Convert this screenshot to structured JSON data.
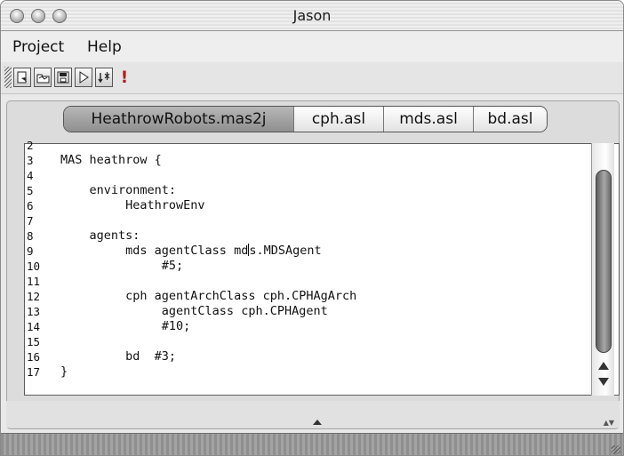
{
  "window": {
    "title": "Jason"
  },
  "menu": {
    "items": [
      "Project",
      "Help"
    ]
  },
  "toolbar": {
    "buttons": [
      {
        "icon": "new-project-icon"
      },
      {
        "icon": "open-project-icon"
      },
      {
        "icon": "save-icon"
      },
      {
        "icon": "run-icon"
      },
      {
        "icon": "debug-icon"
      },
      {
        "icon": "stop-icon",
        "symbol": "!"
      }
    ]
  },
  "tabs": [
    {
      "label": "HeathrowRobots.mas2j",
      "active": true
    },
    {
      "label": "cph.asl",
      "active": false
    },
    {
      "label": "mds.asl",
      "active": false
    },
    {
      "label": "bd.asl",
      "active": false
    }
  ],
  "editor": {
    "lines": [
      {
        "n": "2",
        "text": ""
      },
      {
        "n": "3",
        "text": "MAS heathrow {"
      },
      {
        "n": "4",
        "text": ""
      },
      {
        "n": "5",
        "text": "    environment:"
      },
      {
        "n": "6",
        "text": "         HeathrowEnv"
      },
      {
        "n": "7",
        "text": ""
      },
      {
        "n": "8",
        "text": "    agents:"
      },
      {
        "n": "9",
        "text": "         mds agentClass md"
      },
      {
        "n": "10",
        "text": "              #5;"
      },
      {
        "n": "11",
        "text": ""
      },
      {
        "n": "12",
        "text": "         cph agentArchClass cph.CPHAgArch"
      },
      {
        "n": "13",
        "text": "              agentClass cph.CPHAgent"
      },
      {
        "n": "14",
        "text": "              #10;"
      },
      {
        "n": "15",
        "text": ""
      },
      {
        "n": "16",
        "text": "         bd  #3;"
      },
      {
        "n": "17",
        "text": "}"
      }
    ],
    "caret_line_suffix": "s.MDSAgent"
  },
  "colors": {
    "active_tab": "#a3a3a3",
    "editor_bg": "#ffffff",
    "window_bg": "#e9e9e9"
  }
}
